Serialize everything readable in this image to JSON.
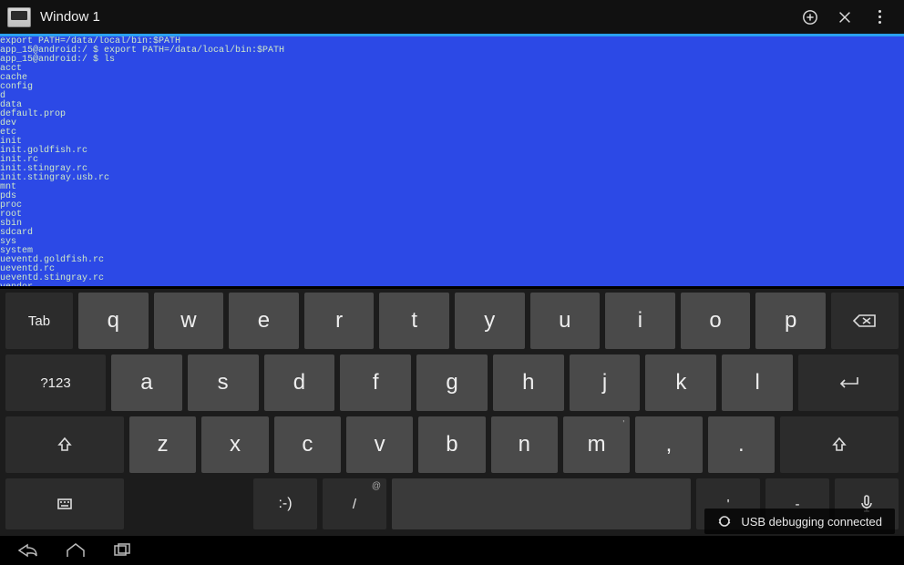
{
  "header": {
    "title": "Window 1"
  },
  "terminal": {
    "lines": [
      "export PATH=/data/local/bin:$PATH",
      "app_15@android:/ $ export PATH=/data/local/bin:$PATH",
      "app_15@android:/ $ ls",
      "acct",
      "cache",
      "config",
      "d",
      "data",
      "default.prop",
      "dev",
      "etc",
      "init",
      "init.goldfish.rc",
      "init.rc",
      "init.stingray.rc",
      "init.stingray.usb.rc",
      "mnt",
      "pds",
      "proc",
      "root",
      "sbin",
      "sdcard",
      "sys",
      "system",
      "ueventd.goldfish.rc",
      "ueventd.rc",
      "ueventd.stingray.rc",
      "vendor"
    ],
    "prompt": "app_15@android:/ $ "
  },
  "keyboard": {
    "tab": "Tab",
    "sym": "?123",
    "row1": [
      "q",
      "w",
      "e",
      "r",
      "t",
      "y",
      "u",
      "i",
      "o",
      "p"
    ],
    "row2": [
      "a",
      "s",
      "d",
      "f",
      "g",
      "h",
      "j",
      "k",
      "l"
    ],
    "row3": [
      "z",
      "x",
      "c",
      "v",
      "b",
      "n",
      "m",
      ",",
      "."
    ],
    "smile": ":-)",
    "slash": "/",
    "slash_hint": "@",
    "apos": "'",
    "dash": "-",
    "m_hint": "'"
  },
  "notification": {
    "text": "USB debugging connected"
  }
}
